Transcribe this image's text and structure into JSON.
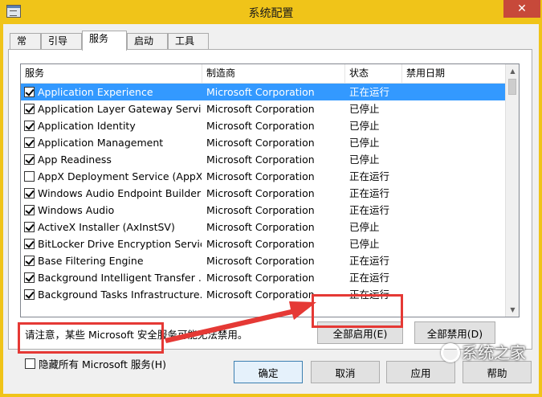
{
  "window": {
    "title": "系统配置",
    "close_glyph": "✕"
  },
  "tabs": [
    {
      "label": "常规",
      "active": false
    },
    {
      "label": "引导",
      "active": false
    },
    {
      "label": "服务",
      "active": true
    },
    {
      "label": "启动",
      "active": false
    },
    {
      "label": "工具",
      "active": false
    }
  ],
  "columns": {
    "service": "服务",
    "manufacturer": "制造商",
    "status": "状态",
    "disabled_date": "禁用日期"
  },
  "services": [
    {
      "name": "Application Experience",
      "manufacturer": "Microsoft Corporation",
      "status": "正在运行",
      "checked": true,
      "selected": true
    },
    {
      "name": "Application Layer Gateway Service",
      "manufacturer": "Microsoft Corporation",
      "status": "已停止",
      "checked": true,
      "selected": false
    },
    {
      "name": "Application Identity",
      "manufacturer": "Microsoft Corporation",
      "status": "已停止",
      "checked": true,
      "selected": false
    },
    {
      "name": "Application Management",
      "manufacturer": "Microsoft Corporation",
      "status": "已停止",
      "checked": true,
      "selected": false
    },
    {
      "name": "App Readiness",
      "manufacturer": "Microsoft Corporation",
      "status": "已停止",
      "checked": true,
      "selected": false
    },
    {
      "name": "AppX Deployment Service (AppX...",
      "manufacturer": "Microsoft Corporation",
      "status": "正在运行",
      "checked": false,
      "selected": false
    },
    {
      "name": "Windows Audio Endpoint Builder",
      "manufacturer": "Microsoft Corporation",
      "status": "正在运行",
      "checked": true,
      "selected": false
    },
    {
      "name": "Windows Audio",
      "manufacturer": "Microsoft Corporation",
      "status": "正在运行",
      "checked": true,
      "selected": false
    },
    {
      "name": "ActiveX Installer (AxInstSV)",
      "manufacturer": "Microsoft Corporation",
      "status": "已停止",
      "checked": true,
      "selected": false
    },
    {
      "name": "BitLocker Drive Encryption Service",
      "manufacturer": "Microsoft Corporation",
      "status": "已停止",
      "checked": true,
      "selected": false
    },
    {
      "name": "Base Filtering Engine",
      "manufacturer": "Microsoft Corporation",
      "status": "正在运行",
      "checked": true,
      "selected": false
    },
    {
      "name": "Background Intelligent Transfer ...",
      "manufacturer": "Microsoft Corporation",
      "status": "正在运行",
      "checked": true,
      "selected": false
    },
    {
      "name": "Background Tasks Infrastructure...",
      "manufacturer": "Microsoft Corporation",
      "status": "正在运行",
      "checked": true,
      "selected": false
    }
  ],
  "note": "请注意，某些 Microsoft 安全服务可能无法禁用。",
  "buttons": {
    "enable_all": "全部启用(E)",
    "disable_all": "全部禁用(D)",
    "ok": "确定",
    "cancel": "取消",
    "apply": "应用",
    "help": "帮助"
  },
  "hide_ms_label": "隐藏所有 Microsoft 服务(H)",
  "watermark": "系统之家",
  "colors": {
    "title_bar": "#f0c419",
    "selection": "#3399ff",
    "highlight": "#e53935"
  }
}
